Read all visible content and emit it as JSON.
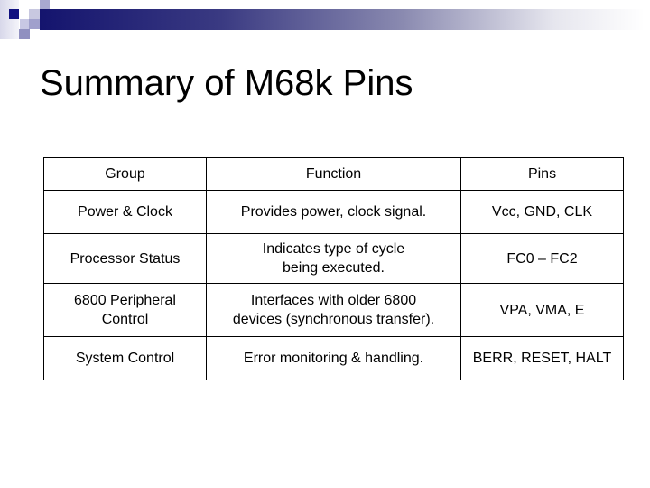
{
  "slide": {
    "title": "Summary of M68k Pins",
    "decoration": {
      "bar_gradient_start": "#14146e",
      "bar_gradient_end": "#ffffff",
      "square_colors": [
        "#e0e0ee",
        "#101080",
        "#c8c8e0",
        "#9090c0",
        "#202088"
      ]
    }
  },
  "table": {
    "headers": [
      "Group",
      "Function",
      "Pins"
    ],
    "rows": [
      {
        "group": "Power & Clock",
        "function": [
          "Provides power, clock signal."
        ],
        "pins": "Vcc, GND, CLK"
      },
      {
        "group": "Processor Status",
        "function": [
          "Indicates type of cycle",
          "being executed."
        ],
        "pins": "FC0 – FC2"
      },
      {
        "group_lines": [
          "6800 Peripheral",
          "Control"
        ],
        "function": [
          "Interfaces with older 6800",
          "devices (synchronous transfer)."
        ],
        "pins": "VPA, VMA, E"
      },
      {
        "group": "System Control",
        "function": [
          "Error monitoring & handling."
        ],
        "pins": "BERR, RESET, HALT"
      }
    ]
  }
}
